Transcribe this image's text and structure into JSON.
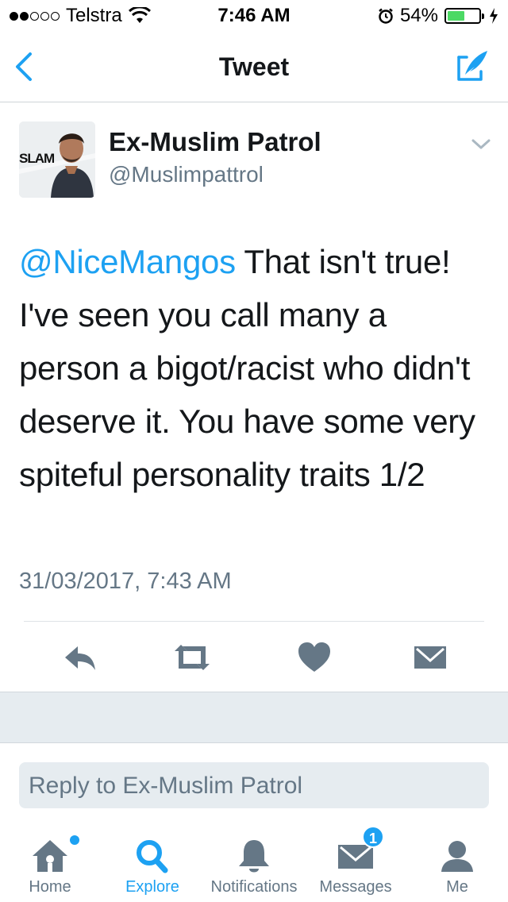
{
  "status_bar": {
    "carrier": "Telstra",
    "time": "7:46 AM",
    "battery": "54%",
    "battery_level": 0.54,
    "icons": [
      "signal-dots-icon",
      "wifi-icon",
      "alarm-icon",
      "battery-icon",
      "charging-bolt-icon"
    ]
  },
  "nav": {
    "title": "Tweet",
    "back_icon": "chevron-left-icon",
    "compose_icon": "compose-tweet-icon"
  },
  "tweet": {
    "avatar_text": "SLAM",
    "display_name": "Ex-Muslim Patrol",
    "username": "@Muslimpattrol",
    "mention": "@NiceMangos",
    "body": " That isn't true! I've seen you call many a person a bigot/racist who didn't deserve it. You have some very spiteful personality traits 1/2",
    "timestamp": "31/03/2017, 7:43 AM"
  },
  "actions": [
    {
      "icon": "reply-icon"
    },
    {
      "icon": "retweet-icon"
    },
    {
      "icon": "like-heart-icon"
    },
    {
      "icon": "direct-message-icon"
    }
  ],
  "reply": {
    "placeholder": "Reply to Ex-Muslim Patrol"
  },
  "tab_bar": {
    "home": "Home",
    "explore": "Explore",
    "notifications": "Notifications",
    "messages": "Messages",
    "me": "Me",
    "messages_badge": "1",
    "active": "Explore"
  },
  "colors": {
    "accent": "#1da1f2",
    "text": "#14171a",
    "secondary": "#657786",
    "battery_green": "#4cd964"
  }
}
